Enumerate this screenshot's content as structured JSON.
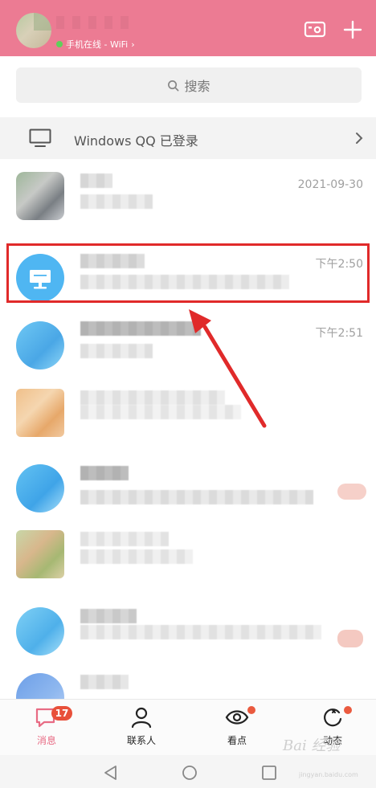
{
  "header": {
    "status_text": "手机在线 - WiFi",
    "chevron": "›",
    "camera_icon": "camera-icon",
    "add_icon": "plus-icon"
  },
  "search": {
    "placeholder": "搜索"
  },
  "device_banner": {
    "label": "Windows QQ 已登录"
  },
  "chats": [
    {
      "time": "2021-09-30"
    },
    {
      "time": "下午2:50"
    },
    {
      "time": "下午2:51"
    }
  ],
  "tabs": [
    {
      "label": "消息",
      "badge": "17"
    },
    {
      "label": "联系人"
    },
    {
      "label": "看点"
    },
    {
      "label": "动态"
    }
  ],
  "watermark": {
    "brand": "Bai 经验",
    "site": "jingyan.baidu.com"
  },
  "colors": {
    "header": "#ec7b93",
    "accent": "#e86b84",
    "highlight": "#e02a2a"
  }
}
